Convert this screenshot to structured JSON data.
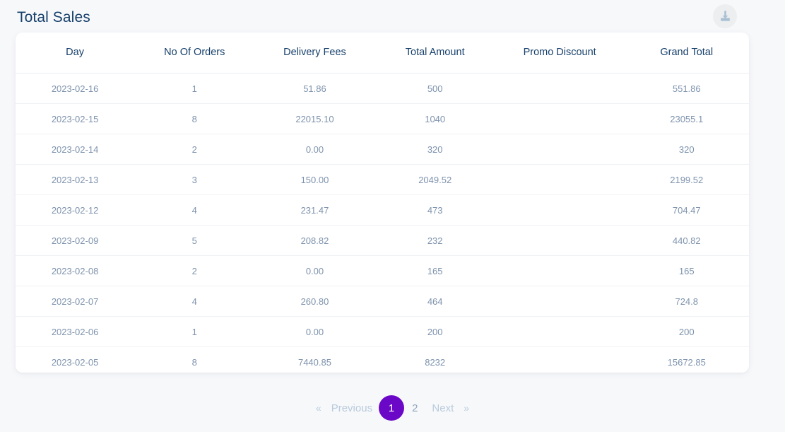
{
  "header": {
    "title": "Total Sales",
    "download_icon": "download-icon",
    "download_label": "Download"
  },
  "table": {
    "columns": [
      "Day",
      "No Of Orders",
      "Delivery Fees",
      "Total Amount",
      "Promo Discount",
      "Grand Total"
    ],
    "rows": [
      {
        "day": "2023-02-16",
        "orders": "1",
        "delivery_fees": "51.86",
        "total_amount": "500",
        "promo_discount": "",
        "grand_total": "551.86"
      },
      {
        "day": "2023-02-15",
        "orders": "8",
        "delivery_fees": "22015.10",
        "total_amount": "1040",
        "promo_discount": "",
        "grand_total": "23055.1"
      },
      {
        "day": "2023-02-14",
        "orders": "2",
        "delivery_fees": "0.00",
        "total_amount": "320",
        "promo_discount": "",
        "grand_total": "320"
      },
      {
        "day": "2023-02-13",
        "orders": "3",
        "delivery_fees": "150.00",
        "total_amount": "2049.52",
        "promo_discount": "",
        "grand_total": "2199.52"
      },
      {
        "day": "2023-02-12",
        "orders": "4",
        "delivery_fees": "231.47",
        "total_amount": "473",
        "promo_discount": "",
        "grand_total": "704.47"
      },
      {
        "day": "2023-02-09",
        "orders": "5",
        "delivery_fees": "208.82",
        "total_amount": "232",
        "promo_discount": "",
        "grand_total": "440.82"
      },
      {
        "day": "2023-02-08",
        "orders": "2",
        "delivery_fees": "0.00",
        "total_amount": "165",
        "promo_discount": "",
        "grand_total": "165"
      },
      {
        "day": "2023-02-07",
        "orders": "4",
        "delivery_fees": "260.80",
        "total_amount": "464",
        "promo_discount": "",
        "grand_total": "724.8"
      },
      {
        "day": "2023-02-06",
        "orders": "1",
        "delivery_fees": "0.00",
        "total_amount": "200",
        "promo_discount": "",
        "grand_total": "200"
      },
      {
        "day": "2023-02-05",
        "orders": "8",
        "delivery_fees": "7440.85",
        "total_amount": "8232",
        "promo_discount": "",
        "grand_total": "15672.85"
      }
    ]
  },
  "pagination": {
    "first_chevron": "«",
    "previous_label": "Previous",
    "pages": [
      "1",
      "2"
    ],
    "active_page": "1",
    "next_label": "Next",
    "last_chevron": "»"
  },
  "colors": {
    "page_background": "#f7f8fa",
    "card_background": "#ffffff",
    "title_text": "#17406b",
    "header_text": "#17406b",
    "cell_text": "#7e93ad",
    "row_divider": "#f0f1f4",
    "accent_purple": "#6b07c6",
    "pagination_muted": "#b9cbdd",
    "download_icon": "#a9bfd2"
  }
}
